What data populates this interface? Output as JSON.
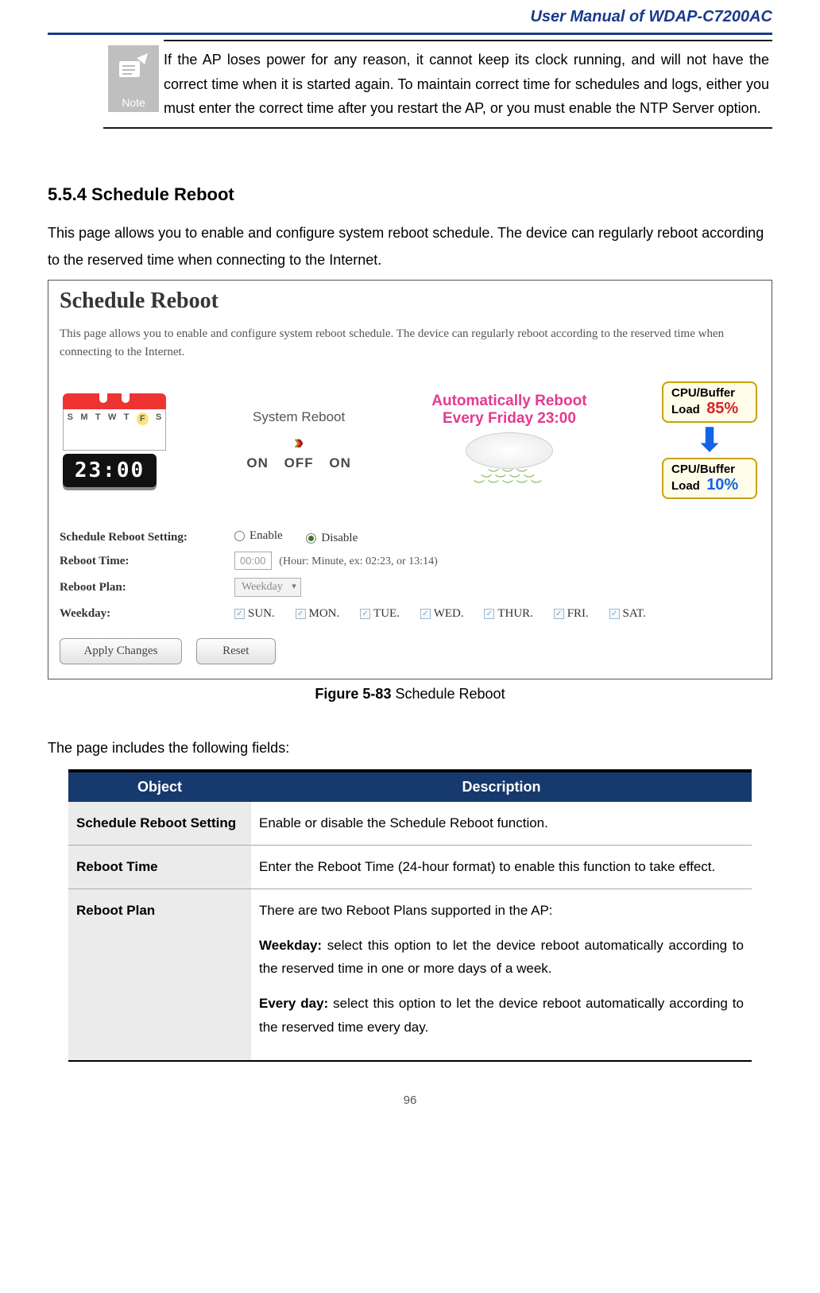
{
  "header": {
    "title": "User Manual of WDAP-C7200AC"
  },
  "note": {
    "icon_label": "Note",
    "text": "If the AP loses power for any reason, it cannot keep its clock running, and will not have the correct time when it is started again. To maintain correct time for schedules and logs, either you must enter the correct time after you restart the AP, or you must enable the NTP Server option."
  },
  "section": {
    "heading": "5.5.4   Schedule Reboot",
    "intro": "This page allows you to enable and configure system reboot schedule. The device can regularly reboot according to the reserved time when connecting to the Internet."
  },
  "screenshot": {
    "title": "Schedule Reboot",
    "desc": "This page allows you to enable and configure system reboot schedule. The device can regularly reboot according to the reserved time when connecting to the Internet.",
    "calendar_days": [
      "S",
      "M",
      "T",
      "W",
      "T",
      "F",
      "S"
    ],
    "clock": "23:00",
    "system_reboot_label": "System Reboot",
    "on_off_on": [
      "ON",
      "OFF",
      "ON"
    ],
    "bubble_l1": "Automatically Reboot",
    "bubble_l2": "Every Friday 23:00",
    "cpu_label": "CPU/Buffer",
    "load_label": "Load",
    "load_hi": "85%",
    "load_lo": "10%",
    "form": {
      "setting_label": "Schedule Reboot Setting:",
      "enable": "Enable",
      "disable": "Disable",
      "reboot_time_label": "Reboot Time:",
      "reboot_time_value": "00:00",
      "reboot_time_hint": "(Hour: Minute, ex: 02:23, or 13:14)",
      "reboot_plan_label": "Reboot Plan:",
      "reboot_plan_value": "Weekday",
      "weekday_label": "Weekday:",
      "weekdays": [
        "SUN.",
        "MON.",
        "TUE.",
        "WED.",
        "THUR.",
        "FRI.",
        "SAT."
      ],
      "apply": "Apply Changes",
      "reset": "Reset"
    }
  },
  "figure": {
    "label": "Figure 5-83",
    "caption": "Schedule Reboot"
  },
  "fields_intro": "The page includes the following fields:",
  "table": {
    "h_object": "Object",
    "h_desc": "Description",
    "rows": [
      {
        "obj": "Schedule Reboot Setting",
        "desc": "Enable or disable the Schedule Reboot function."
      },
      {
        "obj": "Reboot Time",
        "desc": "Enter the Reboot Time (24-hour format) to enable this function to take effect."
      },
      {
        "obj": "Reboot Plan",
        "desc_intro": "There are two Reboot Plans supported in the AP:",
        "weekday_label": "Weekday:",
        "weekday_desc": " select this option to let the device reboot automatically according to the reserved time in one or more days of a week.",
        "everyday_label": "Every day:",
        "everyday_desc": " select this option to let the device reboot automatically according to the reserved time every day."
      }
    ]
  },
  "page_num": "96"
}
